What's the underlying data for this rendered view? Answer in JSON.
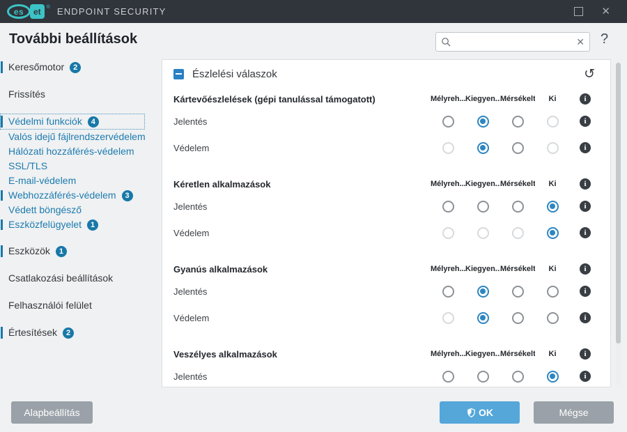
{
  "window": {
    "brand_left": "es",
    "brand_right": "et",
    "product": "ENDPOINT SECURITY"
  },
  "header": {
    "title": "További beállítások",
    "search_value": "",
    "search_placeholder": "",
    "clear_glyph": "✕",
    "help_glyph": "?"
  },
  "sidebar": {
    "items": [
      {
        "label": "Keresőmotor",
        "badge": "2",
        "blue": false,
        "marker": true,
        "selected": false,
        "sub": false,
        "gap": false
      },
      {
        "label": "Frissítés",
        "badge": "",
        "blue": false,
        "marker": false,
        "selected": false,
        "sub": false,
        "gap": true
      },
      {
        "label": "Védelmi funkciók",
        "badge": "4",
        "blue": true,
        "marker": true,
        "selected": true,
        "sub": false,
        "gap": true
      },
      {
        "label": "Valós idejű fájlrendszervédelem",
        "badge": "",
        "blue": true,
        "marker": false,
        "selected": false,
        "sub": true,
        "gap": false
      },
      {
        "label": "Hálózati hozzáférés-védelem",
        "badge": "",
        "blue": true,
        "marker": false,
        "selected": false,
        "sub": true,
        "gap": false
      },
      {
        "label": "SSL/TLS",
        "badge": "",
        "blue": true,
        "marker": false,
        "selected": false,
        "sub": true,
        "gap": false
      },
      {
        "label": "E-mail-védelem",
        "badge": "",
        "blue": true,
        "marker": false,
        "selected": false,
        "sub": true,
        "gap": false
      },
      {
        "label": "Webhozzáférés-védelem",
        "badge": "3",
        "blue": true,
        "marker": true,
        "selected": false,
        "sub": true,
        "gap": false
      },
      {
        "label": "Védett böngésző",
        "badge": "",
        "blue": true,
        "marker": false,
        "selected": false,
        "sub": true,
        "gap": false
      },
      {
        "label": "Eszközfelügyelet",
        "badge": "1",
        "blue": true,
        "marker": true,
        "selected": false,
        "sub": true,
        "gap": false
      },
      {
        "label": "Eszközök",
        "badge": "1",
        "blue": false,
        "marker": true,
        "selected": false,
        "sub": false,
        "gap": true
      },
      {
        "label": "Csatlakozási beállítások",
        "badge": "",
        "blue": false,
        "marker": false,
        "selected": false,
        "sub": false,
        "gap": true
      },
      {
        "label": "Felhasználói felület",
        "badge": "",
        "blue": false,
        "marker": false,
        "selected": false,
        "sub": false,
        "gap": true
      },
      {
        "label": "Értesítések",
        "badge": "2",
        "blue": false,
        "marker": true,
        "selected": false,
        "sub": false,
        "gap": true
      }
    ]
  },
  "panel": {
    "title": "Észlelési válaszok",
    "undo_glyph": "↺",
    "columns": [
      "Mélyreh...",
      "Kiegyen...",
      "Mérsékelt",
      "Ki"
    ],
    "info_glyph": "i",
    "sections": [
      {
        "title": "Kártevőészlelések (gépi tanulással támogatott)",
        "rows": [
          {
            "label": "Jelentés",
            "radios": [
              "enabled",
              "selected",
              "enabled",
              "disabled"
            ]
          },
          {
            "label": "Védelem",
            "radios": [
              "disabled",
              "selected",
              "enabled",
              "disabled"
            ]
          }
        ]
      },
      {
        "title": "Kéretlen alkalmazások",
        "rows": [
          {
            "label": "Jelentés",
            "radios": [
              "enabled",
              "enabled",
              "enabled",
              "selected"
            ]
          },
          {
            "label": "Védelem",
            "radios": [
              "disabled",
              "disabled",
              "disabled",
              "selected"
            ]
          }
        ]
      },
      {
        "title": "Gyanús alkalmazások",
        "rows": [
          {
            "label": "Jelentés",
            "radios": [
              "enabled",
              "selected",
              "enabled",
              "enabled"
            ]
          },
          {
            "label": "Védelem",
            "radios": [
              "disabled",
              "selected",
              "enabled",
              "enabled"
            ]
          }
        ]
      },
      {
        "title": "Veszélyes alkalmazások",
        "rows": [
          {
            "label": "Jelentés",
            "radios": [
              "enabled",
              "enabled",
              "enabled",
              "selected"
            ]
          }
        ]
      }
    ]
  },
  "footer": {
    "default_label": "Alapbeállítás",
    "ok_label": "OK",
    "cancel_label": "Mégse"
  },
  "colors": {
    "titlebar_bg": "#30343b",
    "eset_teal": "#3cc3c6",
    "accent_blue": "#2e86c1",
    "sidebar_link_blue": "#1d7bb0",
    "badge_blue": "#1878a8",
    "ok_button_blue": "#55a7d9",
    "gray_button": "#9aa1a8",
    "background": "#eff1f2"
  }
}
